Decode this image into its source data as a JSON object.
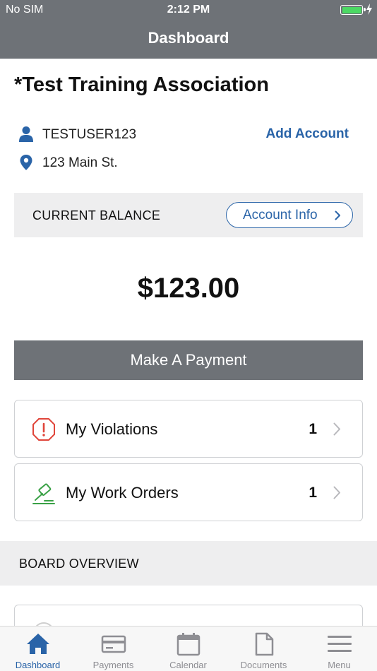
{
  "status_bar": {
    "carrier": "No SIM",
    "time": "2:12 PM"
  },
  "nav": {
    "title": "Dashboard"
  },
  "association": {
    "name": "*Test Training Association",
    "username": "TESTUSER123",
    "address": "123 Main St.",
    "add_account_label": "Add Account"
  },
  "balance": {
    "label": "CURRENT BALANCE",
    "account_info_label": "Account Info",
    "amount": "$123.00",
    "payment_button_label": "Make A Payment"
  },
  "cards": [
    {
      "label": "My Violations",
      "count": "1",
      "icon": "violation-warning-icon",
      "icon_color": "#e0453a"
    },
    {
      "label": "My Work Orders",
      "count": "1",
      "icon": "work-order-hammer-icon",
      "icon_color": "#3aa146"
    }
  ],
  "board": {
    "label": "BOARD OVERVIEW"
  },
  "tabs": [
    {
      "label": "Dashboard",
      "icon": "home-icon",
      "active": true
    },
    {
      "label": "Payments",
      "icon": "credit-card-icon",
      "active": false
    },
    {
      "label": "Calendar",
      "icon": "calendar-icon",
      "active": false
    },
    {
      "label": "Documents",
      "icon": "document-icon",
      "active": false
    },
    {
      "label": "Menu",
      "icon": "hamburger-menu-icon",
      "active": false
    }
  ],
  "colors": {
    "accent": "#2a64a8",
    "header": "#6e7277",
    "section_bg": "#eeeeef",
    "battery": "#4cd964"
  }
}
